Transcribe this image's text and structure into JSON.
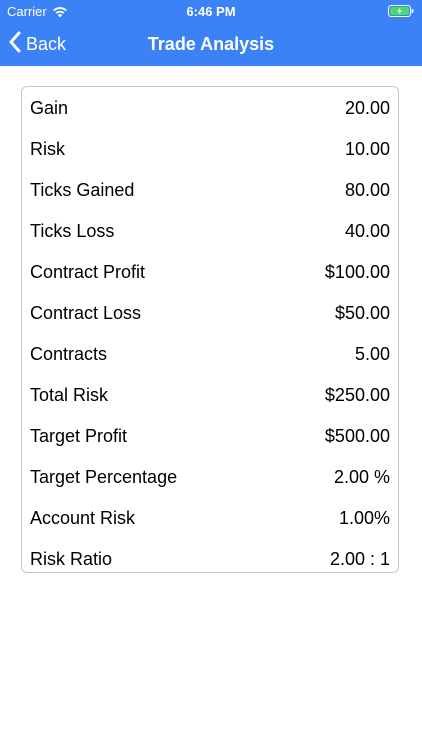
{
  "status_bar": {
    "carrier": "Carrier",
    "time": "6:46 PM",
    "battery_color": "#4cd964"
  },
  "nav": {
    "back_label": "Back",
    "title": "Trade Analysis",
    "bar_color": "#3b82f6"
  },
  "rows": [
    {
      "label": "Gain",
      "value": "20.00"
    },
    {
      "label": "Risk",
      "value": "10.00"
    },
    {
      "label": "Ticks Gained",
      "value": "80.00"
    },
    {
      "label": "Ticks Loss",
      "value": "40.00"
    },
    {
      "label": "Contract Profit",
      "value": "$100.00"
    },
    {
      "label": "Contract Loss",
      "value": "$50.00"
    },
    {
      "label": "Contracts",
      "value": "5.00"
    },
    {
      "label": "Total Risk",
      "value": "$250.00"
    },
    {
      "label": "Target Profit",
      "value": "$500.00"
    },
    {
      "label": "Target Percentage",
      "value": "2.00 %"
    },
    {
      "label": "Account Risk",
      "value": "1.00%"
    },
    {
      "label": "Risk Ratio",
      "value": "2.00 : 1"
    }
  ]
}
